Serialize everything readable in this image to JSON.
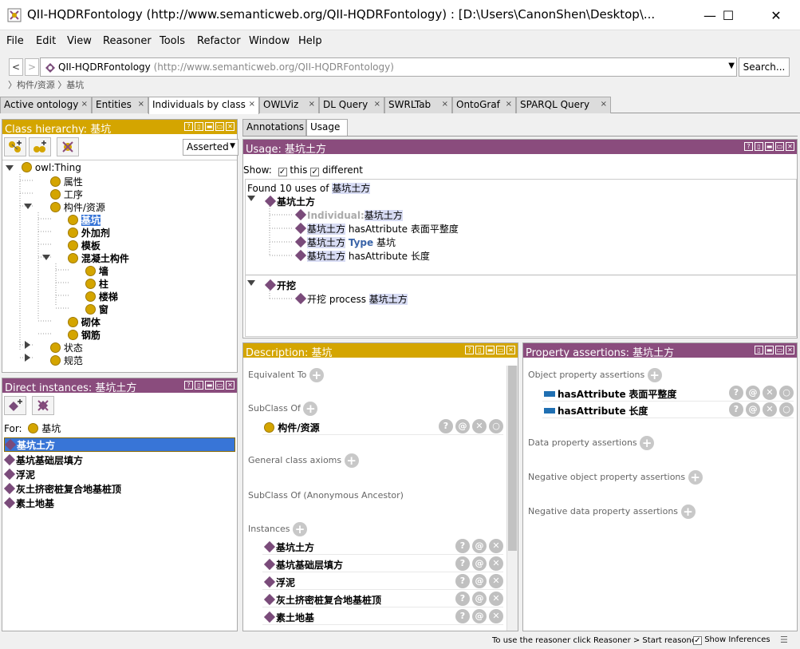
{
  "window": {
    "title": "QII-HQDRFontology (http://www.semanticweb.org/QII-HQDRFontology)  : [D:\\Users\\CanonShen\\Desktop\\...",
    "minimize": "—",
    "maximize": "☐",
    "close": "✕"
  },
  "menu": [
    "File",
    "Edit",
    "View",
    "Reasoner",
    "Tools",
    "Refactor",
    "Window",
    "Help"
  ],
  "nav": {
    "back": "<",
    "forward": ">",
    "ontology_name": "QII-HQDRFontology",
    "ontology_iri": "(http://www.semanticweb.org/QII-HQDRFontology)",
    "search_label": "Search...",
    "breadcrumb": "〉构件/资源 〉基坑"
  },
  "tabs": [
    "Active ontology",
    "Entities",
    "Individuals by class",
    "OWLViz",
    "DL Query",
    "SWRLTab",
    "OntoGraf",
    "SPARQL Query"
  ],
  "active_tab": "Individuals by class",
  "class_hierarchy": {
    "header": "Class hierarchy: 基坑",
    "mode": "Asserted",
    "nodes": [
      {
        "label": "owl:Thing",
        "bold": false
      },
      {
        "label": "属性",
        "bold": false
      },
      {
        "label": "工序",
        "bold": false
      },
      {
        "label": "构件/资源",
        "bold": false
      },
      {
        "label": "基坑",
        "bold": true
      },
      {
        "label": "外加剂",
        "bold": true
      },
      {
        "label": "模板",
        "bold": true
      },
      {
        "label": "混凝土构件",
        "bold": true
      },
      {
        "label": "墙",
        "bold": true
      },
      {
        "label": "柱",
        "bold": true
      },
      {
        "label": "楼梯",
        "bold": true
      },
      {
        "label": "窗",
        "bold": true
      },
      {
        "label": "砌体",
        "bold": true
      },
      {
        "label": "钢筋",
        "bold": true
      },
      {
        "label": "状态",
        "bold": false
      },
      {
        "label": "规范",
        "bold": false
      }
    ]
  },
  "direct_instances": {
    "header": "Direct instances: 基坑土方",
    "for_label": "For:",
    "for_class": "基坑",
    "items": [
      "基坑土方",
      "基坑基础层填方",
      "浮泥",
      "灰土挤密桩复合地基桩顶",
      "素土地基"
    ]
  },
  "usage": {
    "tab_annotations": "Annotations",
    "tab_usage": "Usage",
    "header": "Usage: 基坑土方",
    "show_label": "Show:",
    "this_label": "this",
    "different_label": "different",
    "found_prefix": "Found 10 uses of",
    "found_entity": "基坑土方",
    "groups": [
      {
        "title": "基坑土方",
        "rows": [
          {
            "a": "Individual:",
            "b": "基坑土方",
            "c": "",
            "d": ""
          },
          {
            "a": "基坑土方",
            "b": "hasAttribute",
            "c": "表面平整度",
            "d": ""
          },
          {
            "a": "基坑土方",
            "b": "Type",
            "c": "基坑",
            "d": ""
          },
          {
            "a": "基坑土方",
            "b": "hasAttribute",
            "c": "长度",
            "d": ""
          }
        ]
      },
      {
        "title": "开挖",
        "rows": [
          {
            "a": "开挖",
            "b": "process",
            "c": "基坑土方",
            "d": ""
          }
        ]
      }
    ]
  },
  "description": {
    "header": "Description: 基坑",
    "equivalent_to": "Equivalent To",
    "subclass_of": "SubClass Of",
    "subclass_item": "构件/资源",
    "general_axioms": "General class axioms",
    "anon_ancestor": "SubClass Of (Anonymous Ancestor)",
    "instances_label": "Instances",
    "instances": [
      "基坑土方",
      "基坑基础层填方",
      "浮泥",
      "灰土挤密桩复合地基桩顶",
      "素土地基"
    ]
  },
  "property_assertions": {
    "header": "Property assertions: 基坑土方",
    "object_label": "Object property assertions",
    "object_items": [
      {
        "prop": "hasAttribute",
        "value": "表面平整度"
      },
      {
        "prop": "hasAttribute",
        "value": "长度"
      }
    ],
    "data_label": "Data property assertions",
    "neg_object_label": "Negative object property assertions",
    "neg_data_label": "Negative data property assertions"
  },
  "status": {
    "reasoner_hint": "To use the reasoner click Reasoner > Start reasoner",
    "show_inferences": "Show Inferences"
  },
  "colors": {
    "gold": "#d4a500",
    "purple": "#8a4c7d",
    "selection": "#3875d7",
    "individual": "#7a4b7a"
  }
}
